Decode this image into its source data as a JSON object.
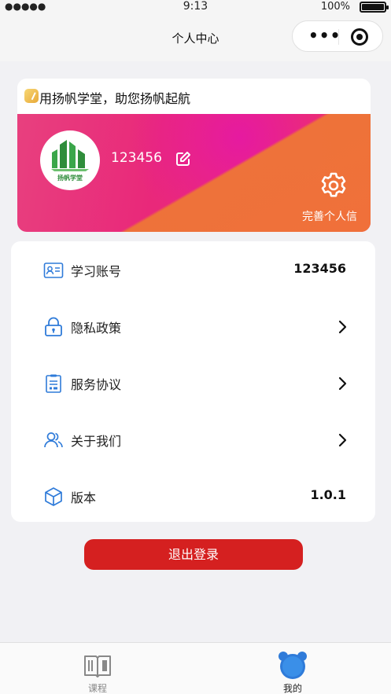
{
  "status_bar": {
    "signal": "●●●●●",
    "time": "9:13",
    "battery_percent": "100%"
  },
  "nav": {
    "title": "个人中心",
    "more_label": "•••"
  },
  "profile": {
    "slogan": "用扬帆学堂，助您扬帆起航",
    "avatar_caption": "扬帆学堂",
    "username": "123456",
    "complete_label": "完善个人信"
  },
  "menu": {
    "items": [
      {
        "label": "学习账号",
        "value": "123456",
        "icon": "id-card-icon"
      },
      {
        "label": "隐私政策",
        "icon": "lock-icon"
      },
      {
        "label": "服务协议",
        "icon": "document-icon"
      },
      {
        "label": "关于我们",
        "icon": "users-icon"
      },
      {
        "label": "版本",
        "value": "1.0.1",
        "icon": "cube-icon"
      }
    ]
  },
  "logout_label": "退出登录",
  "tabs": [
    {
      "label": "课程",
      "icon": "book-icon",
      "active": false
    },
    {
      "label": "我的",
      "icon": "bear-icon",
      "active": true
    }
  ],
  "colors": {
    "accent_blue": "#2f7bd9",
    "logout_red": "#d52020",
    "tab_active": "#2f7bd9"
  }
}
